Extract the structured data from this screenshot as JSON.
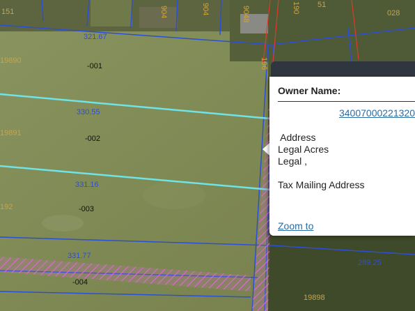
{
  "map": {
    "parcel_labels": [
      {
        "text": "-001"
      },
      {
        "text": "-002"
      },
      {
        "text": "-003"
      },
      {
        "text": "-004"
      }
    ],
    "dimensions": [
      "321.67",
      "330.55",
      "331.16",
      "331.77",
      "289.25"
    ],
    "address_labels": [
      "19890",
      "19891",
      "192",
      "19898",
      "151",
      "51",
      "028",
      "904",
      "904",
      "9048",
      "190",
      "196"
    ],
    "colors": {
      "parcel_line": "#2c4fd6",
      "selected_line": "#6fe3e6",
      "address_text": "#d4a23a",
      "hatch": "#e06ad8"
    }
  },
  "popup": {
    "owner_title": "Owner Name:",
    "parcel_id": "34007000221320",
    "address": " Address",
    "legal_acres": "Legal Acres",
    "legal": "Legal ,",
    "tax_mailing": "Tax Mailing Address",
    "zoom_to": "Zoom to"
  }
}
